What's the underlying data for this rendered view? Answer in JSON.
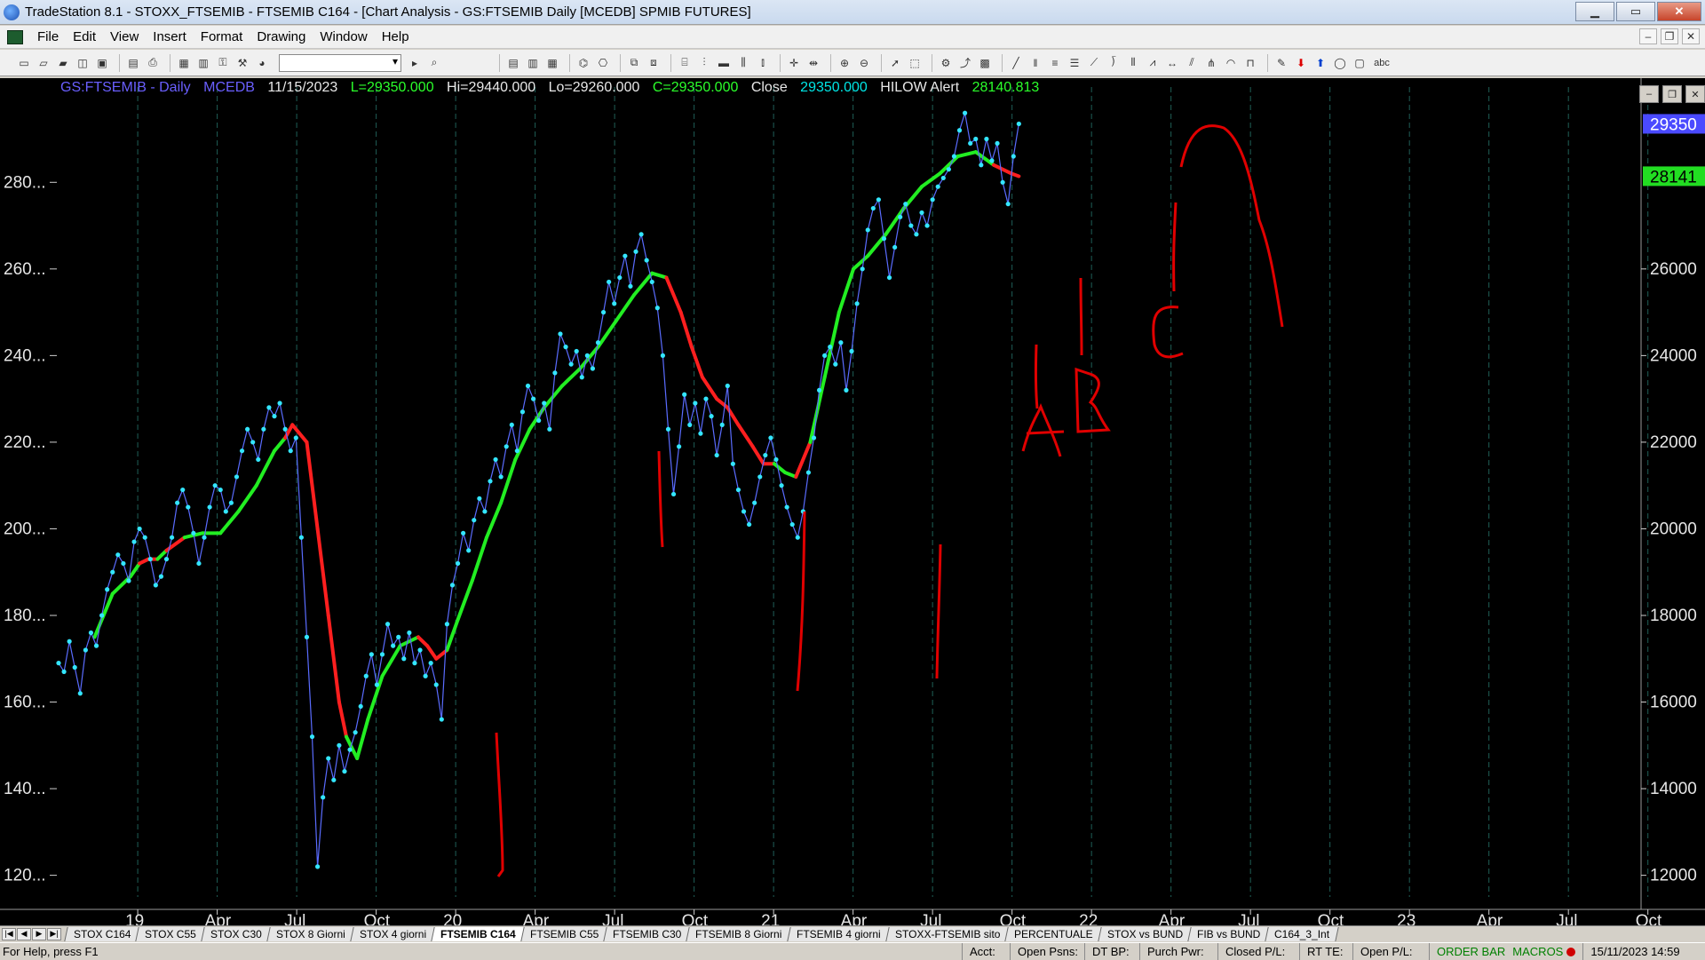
{
  "window": {
    "title": "TradeStation 8.1 - STOXX_FTSEMIB - FTSEMIB C164 - [Chart Analysis - GS:FTSEMIB  Daily  [MCEDB] SPMIB FUTURES]",
    "minimize": "▁",
    "maximize": "▭",
    "close": "✕"
  },
  "menu": {
    "items": [
      "File",
      "Edit",
      "View",
      "Insert",
      "Format",
      "Drawing",
      "Window",
      "Help"
    ],
    "mdi": [
      "–",
      "❐",
      "✕"
    ]
  },
  "toolbar": {
    "combo_value": ""
  },
  "chart_header": {
    "symbol": "GS:FTSEMIB - Daily",
    "source": "MCEDB",
    "date": "11/15/2023",
    "low": "L=29350.000",
    "high": "Hi=29440.000",
    "lo": "Lo=29260.000",
    "close_eq": "C=29350.000",
    "close_label": "Close",
    "close_value": "29350.000",
    "alert_label": "HILOW Alert",
    "alert_value": "28140.813"
  },
  "pane_buttons": [
    "–",
    "❐",
    "✕"
  ],
  "chart_data": {
    "type": "line",
    "title": "",
    "x_ticks": [
      "19",
      "Apr",
      "Jul",
      "Oct",
      "20",
      "Apr",
      "Jul",
      "Oct",
      "21",
      "Apr",
      "Jul",
      "Oct",
      "22",
      "Apr",
      "Jul",
      "Oct",
      "23",
      "Apr",
      "Jul",
      "Oct"
    ],
    "left_axis": {
      "ticks": [
        "280...",
        "260...",
        "240...",
        "220...",
        "200...",
        "180...",
        "160...",
        "140...",
        "120..."
      ],
      "values": [
        28000,
        26000,
        24000,
        22000,
        20000,
        18000,
        16000,
        14000,
        12000
      ]
    },
    "right_axis": {
      "ticks": [
        "26000",
        "24000",
        "22000",
        "20000",
        "18000",
        "16000",
        "14000",
        "12000"
      ],
      "values": [
        26000,
        24000,
        22000,
        20000,
        18000,
        16000,
        14000,
        12000
      ]
    },
    "ylim": [
      11500,
      30200
    ],
    "last_price_label": "29350",
    "alert_price_label": "28141",
    "last_price": 29350,
    "alert_price": 28141,
    "series": [
      {
        "name": "GS:FTSEMIB - Daily",
        "color": "#33e6ff",
        "points": [
          [
            0,
            16900
          ],
          [
            3,
            16700
          ],
          [
            6,
            17400
          ],
          [
            9,
            16800
          ],
          [
            12,
            16200
          ],
          [
            15,
            17200
          ],
          [
            18,
            17600
          ],
          [
            21,
            17300
          ],
          [
            24,
            18000
          ],
          [
            27,
            18600
          ],
          [
            30,
            19000
          ],
          [
            33,
            19400
          ],
          [
            36,
            19200
          ],
          [
            39,
            18800
          ],
          [
            42,
            19700
          ],
          [
            45,
            20000
          ],
          [
            48,
            19800
          ],
          [
            51,
            19300
          ],
          [
            54,
            18700
          ],
          [
            57,
            18900
          ],
          [
            60,
            19300
          ],
          [
            63,
            19800
          ],
          [
            66,
            20600
          ],
          [
            69,
            20900
          ],
          [
            72,
            20500
          ],
          [
            75,
            19900
          ],
          [
            78,
            19200
          ],
          [
            81,
            19800
          ],
          [
            84,
            20500
          ],
          [
            87,
            21000
          ],
          [
            90,
            20900
          ],
          [
            93,
            20400
          ],
          [
            96,
            20600
          ],
          [
            99,
            21200
          ],
          [
            102,
            21800
          ],
          [
            105,
            22300
          ],
          [
            108,
            22000
          ],
          [
            111,
            21600
          ],
          [
            114,
            22300
          ],
          [
            117,
            22800
          ],
          [
            120,
            22600
          ],
          [
            123,
            22900
          ],
          [
            126,
            22300
          ],
          [
            129,
            21800
          ],
          [
            132,
            22100
          ],
          [
            135,
            19800
          ],
          [
            138,
            17500
          ],
          [
            141,
            15200
          ],
          [
            144,
            12200
          ],
          [
            147,
            13800
          ],
          [
            150,
            14700
          ],
          [
            153,
            14200
          ],
          [
            156,
            15000
          ],
          [
            159,
            14400
          ],
          [
            162,
            14900
          ],
          [
            165,
            15300
          ],
          [
            168,
            15900
          ],
          [
            171,
            16600
          ],
          [
            174,
            17100
          ],
          [
            177,
            16400
          ],
          [
            180,
            17100
          ],
          [
            183,
            17800
          ],
          [
            186,
            17300
          ],
          [
            189,
            17500
          ],
          [
            192,
            17000
          ],
          [
            195,
            17600
          ],
          [
            198,
            16900
          ],
          [
            201,
            17200
          ],
          [
            204,
            16600
          ],
          [
            207,
            16900
          ],
          [
            210,
            16400
          ],
          [
            213,
            15600
          ],
          [
            216,
            17800
          ],
          [
            219,
            18700
          ],
          [
            222,
            19200
          ],
          [
            225,
            19900
          ],
          [
            228,
            19500
          ],
          [
            231,
            20200
          ],
          [
            234,
            20700
          ],
          [
            237,
            20400
          ],
          [
            240,
            21100
          ],
          [
            243,
            21600
          ],
          [
            246,
            21200
          ],
          [
            249,
            21900
          ],
          [
            252,
            22400
          ],
          [
            255,
            21800
          ],
          [
            258,
            22700
          ],
          [
            261,
            23300
          ],
          [
            264,
            23000
          ],
          [
            267,
            22500
          ],
          [
            270,
            22900
          ],
          [
            273,
            22300
          ],
          [
            276,
            23600
          ],
          [
            279,
            24500
          ],
          [
            282,
            24200
          ],
          [
            285,
            23800
          ],
          [
            288,
            24100
          ],
          [
            291,
            23500
          ],
          [
            294,
            24000
          ],
          [
            297,
            23700
          ],
          [
            300,
            24300
          ],
          [
            303,
            25000
          ],
          [
            306,
            25700
          ],
          [
            309,
            25200
          ],
          [
            312,
            25800
          ],
          [
            315,
            26300
          ],
          [
            318,
            25600
          ],
          [
            321,
            26400
          ],
          [
            324,
            26800
          ],
          [
            327,
            26200
          ],
          [
            330,
            25700
          ],
          [
            333,
            25100
          ],
          [
            336,
            24000
          ],
          [
            339,
            22300
          ],
          [
            342,
            20800
          ],
          [
            345,
            21900
          ],
          [
            348,
            23100
          ],
          [
            351,
            22400
          ],
          [
            354,
            22900
          ],
          [
            357,
            22200
          ],
          [
            360,
            23000
          ],
          [
            363,
            22600
          ],
          [
            366,
            21700
          ],
          [
            369,
            22400
          ],
          [
            372,
            23300
          ],
          [
            375,
            21500
          ],
          [
            378,
            20900
          ],
          [
            381,
            20400
          ],
          [
            384,
            20100
          ],
          [
            387,
            20600
          ],
          [
            390,
            21200
          ],
          [
            393,
            21700
          ],
          [
            396,
            22100
          ],
          [
            399,
            21600
          ],
          [
            402,
            21000
          ],
          [
            405,
            20500
          ],
          [
            408,
            20100
          ],
          [
            411,
            19800
          ],
          [
            414,
            20400
          ],
          [
            417,
            21300
          ],
          [
            420,
            22100
          ],
          [
            423,
            23200
          ],
          [
            426,
            24000
          ],
          [
            429,
            24200
          ],
          [
            432,
            23800
          ],
          [
            435,
            24300
          ],
          [
            438,
            23200
          ],
          [
            441,
            24100
          ],
          [
            444,
            25200
          ],
          [
            447,
            26000
          ],
          [
            450,
            26900
          ],
          [
            453,
            27400
          ],
          [
            456,
            27600
          ],
          [
            459,
            26700
          ],
          [
            462,
            25800
          ],
          [
            465,
            26500
          ],
          [
            468,
            27200
          ],
          [
            471,
            27500
          ],
          [
            474,
            27000
          ],
          [
            477,
            26800
          ],
          [
            480,
            27300
          ],
          [
            483,
            27000
          ],
          [
            486,
            27600
          ],
          [
            489,
            27900
          ],
          [
            492,
            28100
          ],
          [
            495,
            28300
          ],
          [
            498,
            28600
          ],
          [
            501,
            29200
          ],
          [
            504,
            29600
          ],
          [
            507,
            28900
          ],
          [
            510,
            29000
          ],
          [
            513,
            28400
          ],
          [
            516,
            29000
          ],
          [
            519,
            28500
          ],
          [
            522,
            28900
          ],
          [
            525,
            28000
          ],
          [
            528,
            27500
          ],
          [
            531,
            28600
          ],
          [
            534,
            29350
          ]
        ]
      },
      {
        "name": "HILOW Alert",
        "color_up": "#22ee22",
        "color_down": "#ff1f1f",
        "points": [
          [
            20,
            17500
          ],
          [
            30,
            18500
          ],
          [
            40,
            18900
          ],
          [
            45,
            19200
          ],
          [
            50,
            19300
          ],
          [
            55,
            19300
          ],
          [
            60,
            19500
          ],
          [
            70,
            19800
          ],
          [
            80,
            19900
          ],
          [
            90,
            19900
          ],
          [
            100,
            20400
          ],
          [
            110,
            21000
          ],
          [
            120,
            21800
          ],
          [
            126,
            22100
          ],
          [
            130,
            22400
          ],
          [
            138,
            22000
          ],
          [
            144,
            20000
          ],
          [
            150,
            18000
          ],
          [
            156,
            16000
          ],
          [
            160,
            15200
          ],
          [
            166,
            14700
          ],
          [
            172,
            15600
          ],
          [
            180,
            16600
          ],
          [
            190,
            17300
          ],
          [
            200,
            17500
          ],
          [
            205,
            17300
          ],
          [
            210,
            17000
          ],
          [
            216,
            17200
          ],
          [
            222,
            17900
          ],
          [
            230,
            18800
          ],
          [
            238,
            19800
          ],
          [
            246,
            20600
          ],
          [
            254,
            21600
          ],
          [
            262,
            22300
          ],
          [
            270,
            22800
          ],
          [
            280,
            23300
          ],
          [
            290,
            23700
          ],
          [
            300,
            24200
          ],
          [
            310,
            24800
          ],
          [
            320,
            25400
          ],
          [
            330,
            25900
          ],
          [
            338,
            25800
          ],
          [
            346,
            25000
          ],
          [
            352,
            24200
          ],
          [
            358,
            23500
          ],
          [
            366,
            23000
          ],
          [
            372,
            22800
          ],
          [
            378,
            22400
          ],
          [
            386,
            21900
          ],
          [
            392,
            21500
          ],
          [
            398,
            21500
          ],
          [
            404,
            21300
          ],
          [
            410,
            21200
          ],
          [
            418,
            22000
          ],
          [
            426,
            23500
          ],
          [
            434,
            25000
          ],
          [
            442,
            26000
          ],
          [
            450,
            26300
          ],
          [
            460,
            26800
          ],
          [
            470,
            27400
          ],
          [
            480,
            27900
          ],
          [
            490,
            28200
          ],
          [
            500,
            28600
          ],
          [
            510,
            28700
          ],
          [
            520,
            28400
          ],
          [
            530,
            28200
          ],
          [
            534,
            28140
          ]
        ],
        "down_segments": [
          [
            45,
            55
          ],
          [
            60,
            66
          ],
          [
            126,
            160
          ],
          [
            200,
            216
          ],
          [
            338,
            398
          ],
          [
            410,
            420
          ],
          [
            516,
            534
          ]
        ]
      }
    ],
    "annotations": [
      "A",
      "B",
      "C"
    ]
  },
  "sheet_tabs": {
    "nav": [
      "|◀",
      "◀",
      "▶",
      "▶|"
    ],
    "tabs": [
      "STOX C164",
      "STOX C55",
      "STOX  C30",
      "STOX  8 Giorni",
      "STOX 4 giorni",
      "FTSEMIB C164",
      "FTSEMIB C55",
      "FTSEMIB C30",
      "FTSEMIB  8 Giorni",
      "FTSEMIB  4 giorni",
      "STOXX-FTSEMIB sito",
      "PERCENTUALE",
      "STOX vs BUND",
      "FIB vs BUND",
      "C164_3_Int"
    ],
    "active": "FTSEMIB C164"
  },
  "status": {
    "help": "For Help, press F1",
    "acct": "Acct:",
    "open_psns": "Open Psns:",
    "dt_bp": "DT BP:",
    "purch_pwr": "Purch Pwr:",
    "closed_pl": "Closed P/L:",
    "rt_te": "RT TE:",
    "open_pl": "Open P/L:",
    "order_bar": "ORDER BAR",
    "macros": "MACROS",
    "datetime": "15/11/2023 14:59"
  }
}
